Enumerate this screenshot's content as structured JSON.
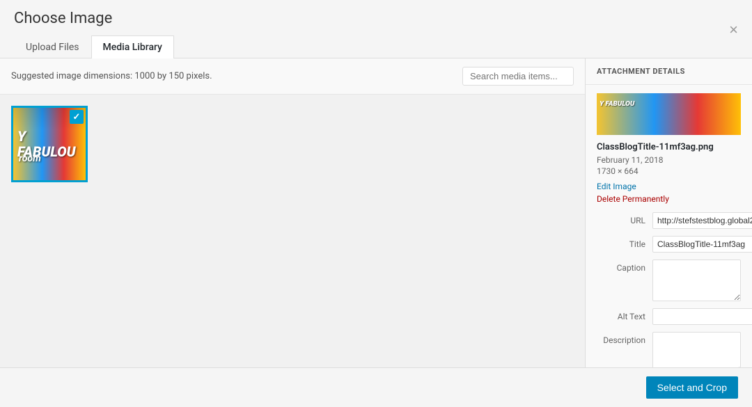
{
  "modal": {
    "title": "Choose Image",
    "close_label": "×"
  },
  "tabs": {
    "upload_label": "Upload Files",
    "library_label": "Media Library"
  },
  "toolbar": {
    "suggested_text": "Suggested image dimensions: 1000 by 150 pixels.",
    "search_placeholder": "Search media items..."
  },
  "attachment_details": {
    "header": "ATTACHMENT DETAILS",
    "filename": "ClassBlogTitle-11mf3ag.png",
    "date": "February 11, 2018",
    "dimensions": "1730 × 664",
    "edit_label": "Edit Image",
    "delete_label": "Delete Permanently",
    "fields": {
      "url_label": "URL",
      "url_value": "http://stefstestblog.global2",
      "title_label": "Title",
      "title_value": "ClassBlogTitle-11mf3ag",
      "caption_label": "Caption",
      "caption_value": "",
      "alt_label": "Alt Text",
      "alt_value": "",
      "description_label": "Description",
      "description_value": ""
    }
  },
  "footer": {
    "select_crop_label": "Select and Crop"
  },
  "media_item": {
    "text_line1": "Y FABULOU",
    "text_line2": "room"
  }
}
